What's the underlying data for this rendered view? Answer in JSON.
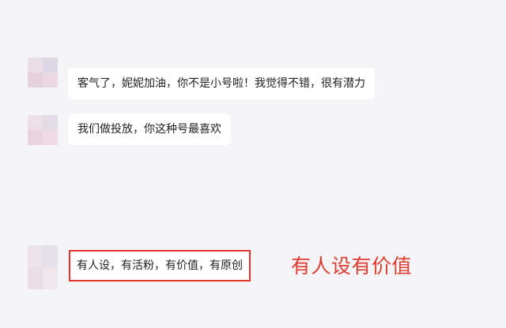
{
  "messages": [
    {
      "text": "客气了，妮妮加油，你不是小号啦！我觉得不错，很有潜力"
    },
    {
      "text": "我们做投放，你这种号最喜欢"
    },
    {
      "text": "有人设，有活粉，有价值，有原创"
    }
  ],
  "annotation": {
    "text": "有人设有价值",
    "color": "#e23b2f"
  },
  "colors": {
    "background": "#f5f5f7",
    "bubble": "#ffffff",
    "highlight_border": "#e5322b"
  }
}
